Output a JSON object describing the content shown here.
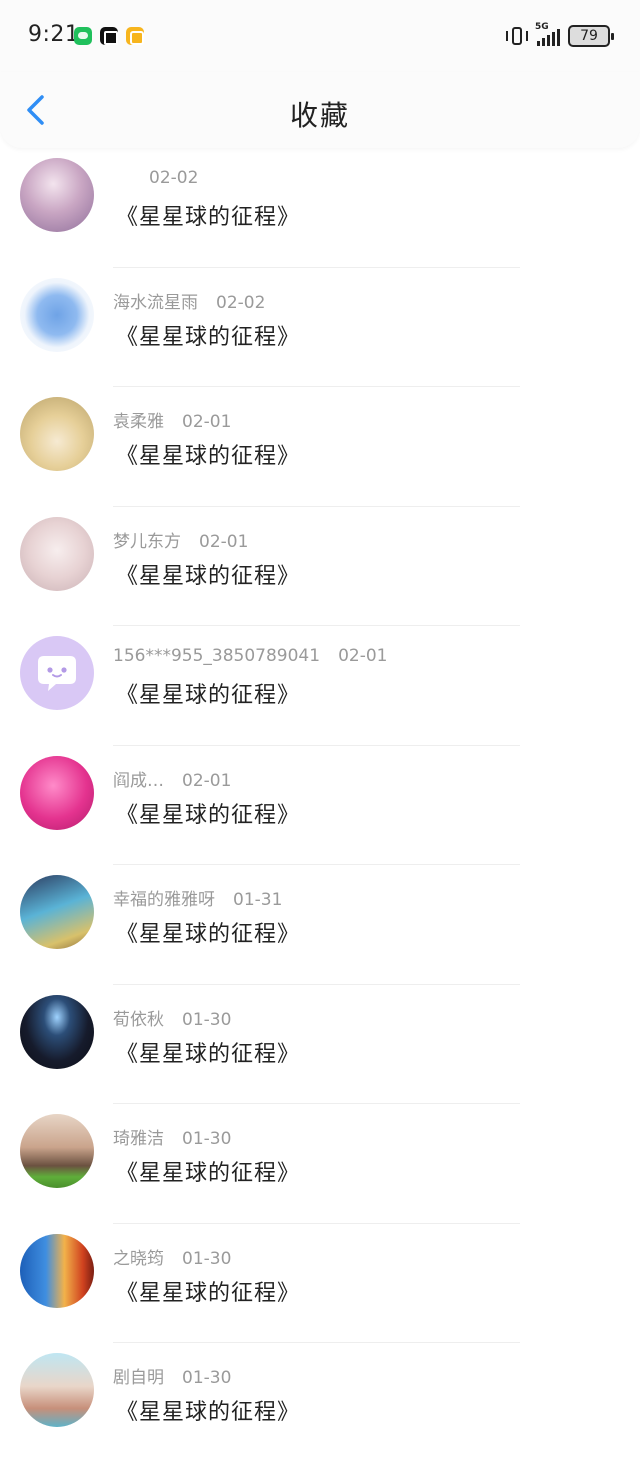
{
  "status": {
    "time": "9:21",
    "network": "5G",
    "battery": "79",
    "app_icons": [
      "wechat-icon",
      "capcut-icon",
      "notes-icon"
    ]
  },
  "header": {
    "title": "收藏",
    "back_icon": "chevron-left-icon"
  },
  "colors": {
    "accent": "#2f8ef5",
    "muted_text": "#9a9a9a"
  },
  "items": [
    {
      "name": "",
      "date": "02-02",
      "text": "《星星球的征程》"
    },
    {
      "name": "海水流星雨",
      "date": "02-02",
      "text": "《星星球的征程》"
    },
    {
      "name": "袁柔雅",
      "date": "02-01",
      "text": "《星星球的征程》"
    },
    {
      "name": "梦儿东方",
      "date": "02-01",
      "text": "《星星球的征程》"
    },
    {
      "name": "156***955_3850789041",
      "date": "02-01",
      "text": "《星星球的征程》"
    },
    {
      "name": "阎成…",
      "date": "02-01",
      "text": "《星星球的征程》"
    },
    {
      "name": "幸福的雅雅呀",
      "date": "01-31",
      "text": "《星星球的征程》"
    },
    {
      "name": "荀依秋",
      "date": "01-30",
      "text": "《星星球的征程》"
    },
    {
      "name": "琦雅洁",
      "date": "01-30",
      "text": "《星星球的征程》"
    },
    {
      "name": "之晓筠",
      "date": "01-30",
      "text": "《星星球的征程》"
    },
    {
      "name": "剧自明",
      "date": "01-30",
      "text": "《星星球的征程》"
    }
  ]
}
